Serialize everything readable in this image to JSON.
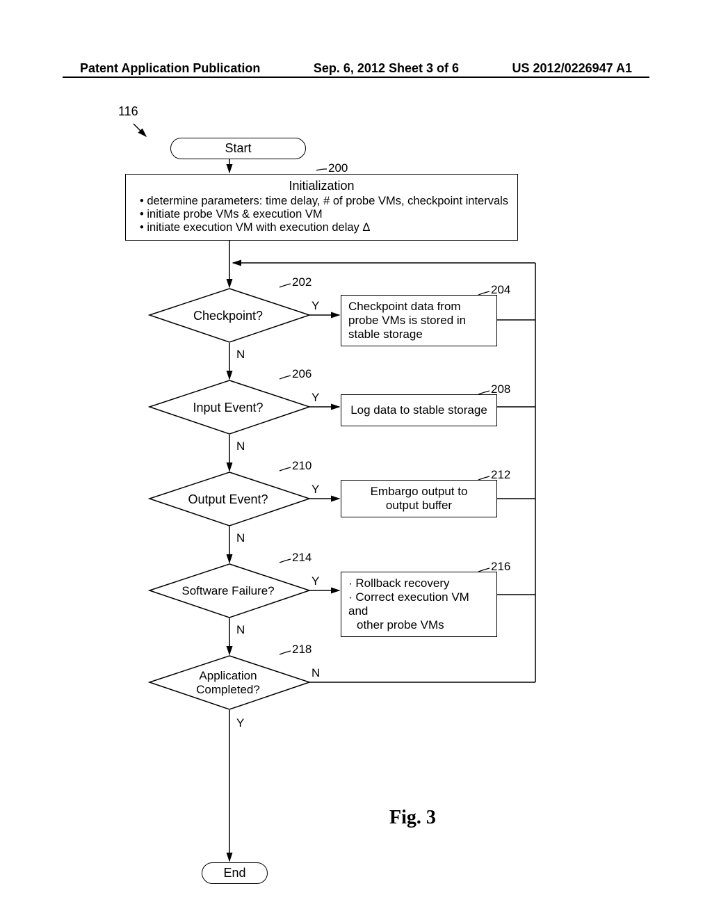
{
  "header": {
    "left": "Patent Application Publication",
    "center": "Sep. 6, 2012   Sheet 3 of 6",
    "right": "US 2012/0226947 A1"
  },
  "refs": {
    "main": "116",
    "r200": "200",
    "r202": "202",
    "r204": "204",
    "r206": "206",
    "r208": "208",
    "r210": "210",
    "r212": "212",
    "r214": "214",
    "r216": "216",
    "r218": "218"
  },
  "terminals": {
    "start": "Start",
    "end": "End"
  },
  "init": {
    "title": "Initialization",
    "b1": "determine parameters:  time delay, # of probe VMs, checkpoint intervals",
    "b2": "initiate probe VMs & execution VM",
    "b3": "initiate execution VM with execution delay Δ"
  },
  "decisions": {
    "d1": "Checkpoint?",
    "d2": "Input Event?",
    "d3": "Output Event?",
    "d4": "Software Failure?",
    "d5_l1": "Application",
    "d5_l2": "Completed?"
  },
  "boxes": {
    "b204": "Checkpoint data from probe VMs is stored in stable storage",
    "b208": "Log data to stable storage",
    "b212_l1": "Embargo output to",
    "b212_l2": "output buffer",
    "b216_l1": "· Rollback recovery",
    "b216_l2": "· Correct execution VM and",
    "b216_l3": "other probe VMs"
  },
  "labels": {
    "yes": "Y",
    "no": "N"
  },
  "figure": "Fig. 3",
  "chart_data": {
    "type": "flowchart",
    "nodes": [
      {
        "id": "start",
        "type": "terminal",
        "label": "Start"
      },
      {
        "id": "200",
        "type": "process",
        "label": "Initialization",
        "details": [
          "determine parameters: time delay, # of probe VMs, checkpoint intervals",
          "initiate probe VMs & execution VM",
          "initiate execution VM with execution delay Δ"
        ]
      },
      {
        "id": "202",
        "type": "decision",
        "label": "Checkpoint?"
      },
      {
        "id": "204",
        "type": "process",
        "label": "Checkpoint data from probe VMs is stored in stable storage"
      },
      {
        "id": "206",
        "type": "decision",
        "label": "Input Event?"
      },
      {
        "id": "208",
        "type": "process",
        "label": "Log data to stable storage"
      },
      {
        "id": "210",
        "type": "decision",
        "label": "Output Event?"
      },
      {
        "id": "212",
        "type": "process",
        "label": "Embargo output to output buffer"
      },
      {
        "id": "214",
        "type": "decision",
        "label": "Software Failure?"
      },
      {
        "id": "216",
        "type": "process",
        "label": "Rollback recovery; Correct execution VM and other probe VMs"
      },
      {
        "id": "218",
        "type": "decision",
        "label": "Application Completed?"
      },
      {
        "id": "end",
        "type": "terminal",
        "label": "End"
      }
    ],
    "edges": [
      {
        "from": "start",
        "to": "200"
      },
      {
        "from": "200",
        "to": "202"
      },
      {
        "from": "202",
        "to": "204",
        "label": "Y"
      },
      {
        "from": "202",
        "to": "206",
        "label": "N"
      },
      {
        "from": "204",
        "to": "202",
        "loop": true
      },
      {
        "from": "206",
        "to": "208",
        "label": "Y"
      },
      {
        "from": "206",
        "to": "210",
        "label": "N"
      },
      {
        "from": "208",
        "to": "202",
        "loop": true
      },
      {
        "from": "210",
        "to": "212",
        "label": "Y"
      },
      {
        "from": "210",
        "to": "214",
        "label": "N"
      },
      {
        "from": "212",
        "to": "202",
        "loop": true
      },
      {
        "from": "214",
        "to": "216",
        "label": "Y"
      },
      {
        "from": "214",
        "to": "218",
        "label": "N"
      },
      {
        "from": "216",
        "to": "202",
        "loop": true
      },
      {
        "from": "218",
        "to": "202",
        "label": "N",
        "loop": true
      },
      {
        "from": "218",
        "to": "end",
        "label": "Y"
      }
    ]
  }
}
